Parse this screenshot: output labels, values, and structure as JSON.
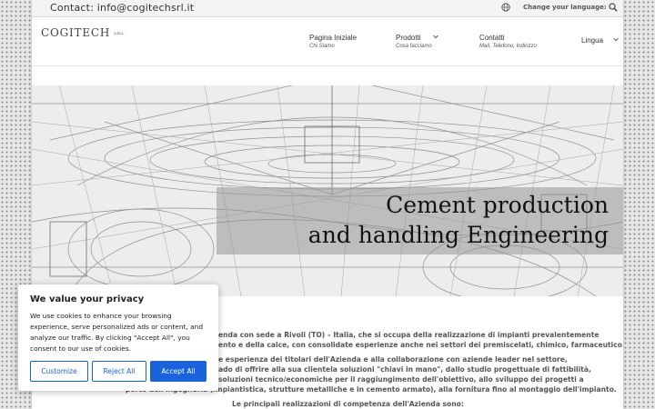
{
  "topbar": {
    "contact": "Contact: info@cogitechsrl.it",
    "language_label": "Change your language:",
    "icons": [
      "globe-icon",
      "search-icon"
    ]
  },
  "header": {
    "logo": "COGITECH",
    "logo_suffix": "S.R.L.",
    "nav": [
      {
        "label": "Pagina Iniziale",
        "sub": "Chi Siamo"
      },
      {
        "label": "Prodotti",
        "sub": "Cosa facciamo"
      },
      {
        "label": "Contatti",
        "sub": "Mail, Telefono, Indirizzo"
      },
      {
        "label": "Lingua",
        "sub": ""
      }
    ]
  },
  "hero": {
    "line1": "Cement production",
    "line2": "and handling Engineering"
  },
  "content": {
    "p1_line1": "enda con sede a Rivoli (TO) – Italia, che si occupa della realizzazione di impianti prevalentemente",
    "p1_line2": "ento e della calce, con consolidate esperienze anche nei settori dei premiscelati, chimico, farmaceutico.",
    "p2_line1": "e esperienza dei titolari dell'Azienda e alla collaborazione con aziende leader nel settore,",
    "p2_line2": "ado di offrire alla sua clientela soluzioni \"chiavi in mano\", dallo studio progettuale di fattibilità,",
    "p2_line3": "soluzioni tecnico/economiche per il raggiungimento dell'obiettivo, allo sviluppo dei progetti a",
    "p2_line4": "porto dell'ingegneria (impiantistica, strutture metalliche e in cemento armato), alla fornitura fino al montaggio dell'impianto.",
    "p3": "Le principali realizzazioni di competenza dell'Azienda sono:"
  },
  "cookie": {
    "title": "We value your privacy",
    "text": "We use cookies to enhance your browsing experience, serve personalized ads or content, and analyze our traffic. By clicking \"Accept All\", you consent to our use of cookies.",
    "customize": "Customize",
    "reject": "Reject All",
    "accept": "Accept All"
  },
  "colors": {
    "accent": "#1863dc",
    "caption_bg": "#969696",
    "text": "#555555"
  }
}
